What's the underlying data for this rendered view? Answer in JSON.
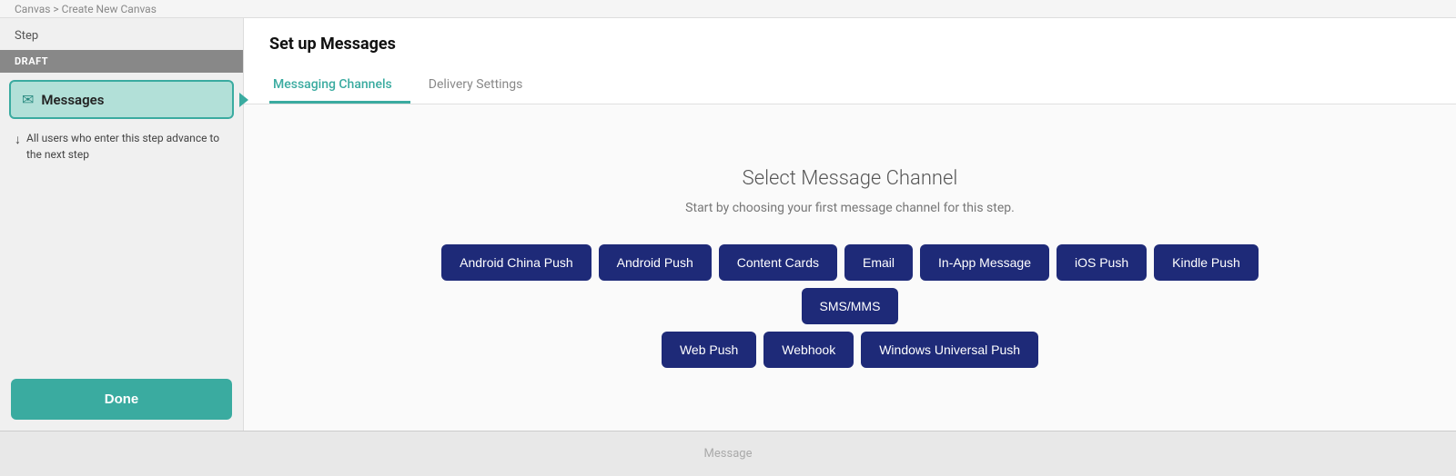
{
  "topbar": {
    "breadcrumb": "Canvas > Create New Canvas"
  },
  "sidebar": {
    "step_label": "Step",
    "draft_badge": "DRAFT",
    "messages_item_label": "Messages",
    "info_text": "All users who enter this step advance to the next step",
    "done_button_label": "Done"
  },
  "main": {
    "title": "Set up Messages",
    "tabs": [
      {
        "label": "Messaging Channels",
        "active": true
      },
      {
        "label": "Delivery Settings",
        "active": false
      }
    ],
    "channel_selection": {
      "title": "Select Message Channel",
      "subtitle": "Start by choosing your first message channel for this step.",
      "buttons_row1": [
        "Android China Push",
        "Android Push",
        "Content Cards",
        "Email",
        "In-App Message",
        "iOS Push",
        "Kindle Push",
        "SMS/MMS"
      ],
      "buttons_row2": [
        "Web Push",
        "Webhook",
        "Windows Universal Push"
      ]
    }
  },
  "bottom": {
    "message_text": "Message"
  }
}
